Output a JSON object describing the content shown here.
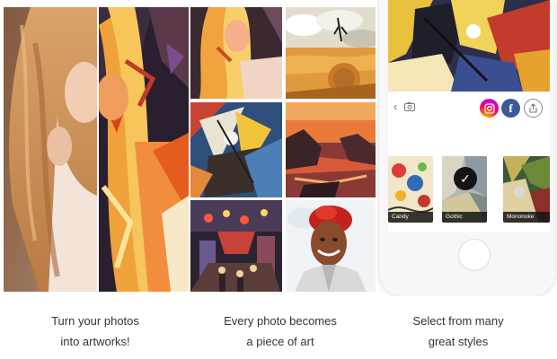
{
  "panels": [
    {
      "id": "portrait-split",
      "caption": {
        "line1": "Turn your photos",
        "line2": "into artworks!"
      }
    },
    {
      "id": "artwork-grid",
      "caption": {
        "line1": "Every photo becomes",
        "line2": "a piece of art"
      }
    },
    {
      "id": "style-picker",
      "caption": {
        "line1": "Select from many",
        "line2": "great styles"
      }
    }
  ],
  "phone": {
    "toolbar": {
      "back_icon": "back-icon",
      "camera_icon": "camera-icon",
      "share_buttons": [
        {
          "icon": "instagram-icon",
          "color": "#ff0069"
        },
        {
          "icon": "facebook-icon",
          "glyph": "f",
          "color": "#3b5998"
        },
        {
          "icon": "export-icon",
          "color": "#888888"
        }
      ]
    },
    "styles": [
      {
        "label": "Candy",
        "selected": false
      },
      {
        "label": "Gothic",
        "selected": true
      },
      {
        "label": "Mononoke",
        "selected": false
      }
    ]
  },
  "colors": {
    "caption_text": "#333333",
    "background": "#ffffff",
    "style_label_bg": "#141414"
  }
}
